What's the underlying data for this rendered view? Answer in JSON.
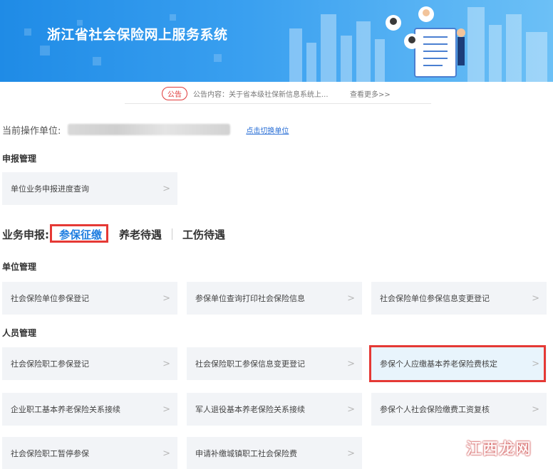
{
  "header": {
    "title": "浙江省社会保险网上服务系统"
  },
  "notice": {
    "badge": "公告",
    "text": "公告内容：关于省本级社保新信息系统上...",
    "more": "查看更多>>"
  },
  "unit": {
    "label": "当前操作单位:",
    "switch_link": "点击切换单位"
  },
  "declaration_mgmt": {
    "title": "申报管理",
    "items": [
      {
        "label": "单位业务申报进度查询"
      }
    ]
  },
  "business_tabs": {
    "label": "业务申报:",
    "tabs": [
      "参保征缴",
      "养老待遇",
      "工伤待遇"
    ]
  },
  "unit_mgmt": {
    "title": "单位管理",
    "items": [
      {
        "label": "社会保险单位参保登记"
      },
      {
        "label": "参保单位查询打印社会保险信息"
      },
      {
        "label": "社会保险单位参保信息变更登记"
      }
    ]
  },
  "person_mgmt": {
    "title": "人员管理",
    "items": [
      {
        "label": "社会保险职工参保登记"
      },
      {
        "label": "社会保险职工参保信息变更登记"
      },
      {
        "label": "参保个人应缴基本养老保险费核定"
      },
      {
        "label": "企业职工基本养老保险关系接续"
      },
      {
        "label": "军人退役基本养老保险关系接续"
      },
      {
        "label": "参保个人社会保险缴费工资复核"
      },
      {
        "label": "社会保险职工暂停参保"
      },
      {
        "label": "申请补缴城镇职工社会保险费"
      }
    ]
  },
  "watermark": "江西龙网",
  "colors": {
    "banner": "#2a93ea",
    "accent": "#1f7ee0",
    "highlight_border": "#e53935"
  }
}
